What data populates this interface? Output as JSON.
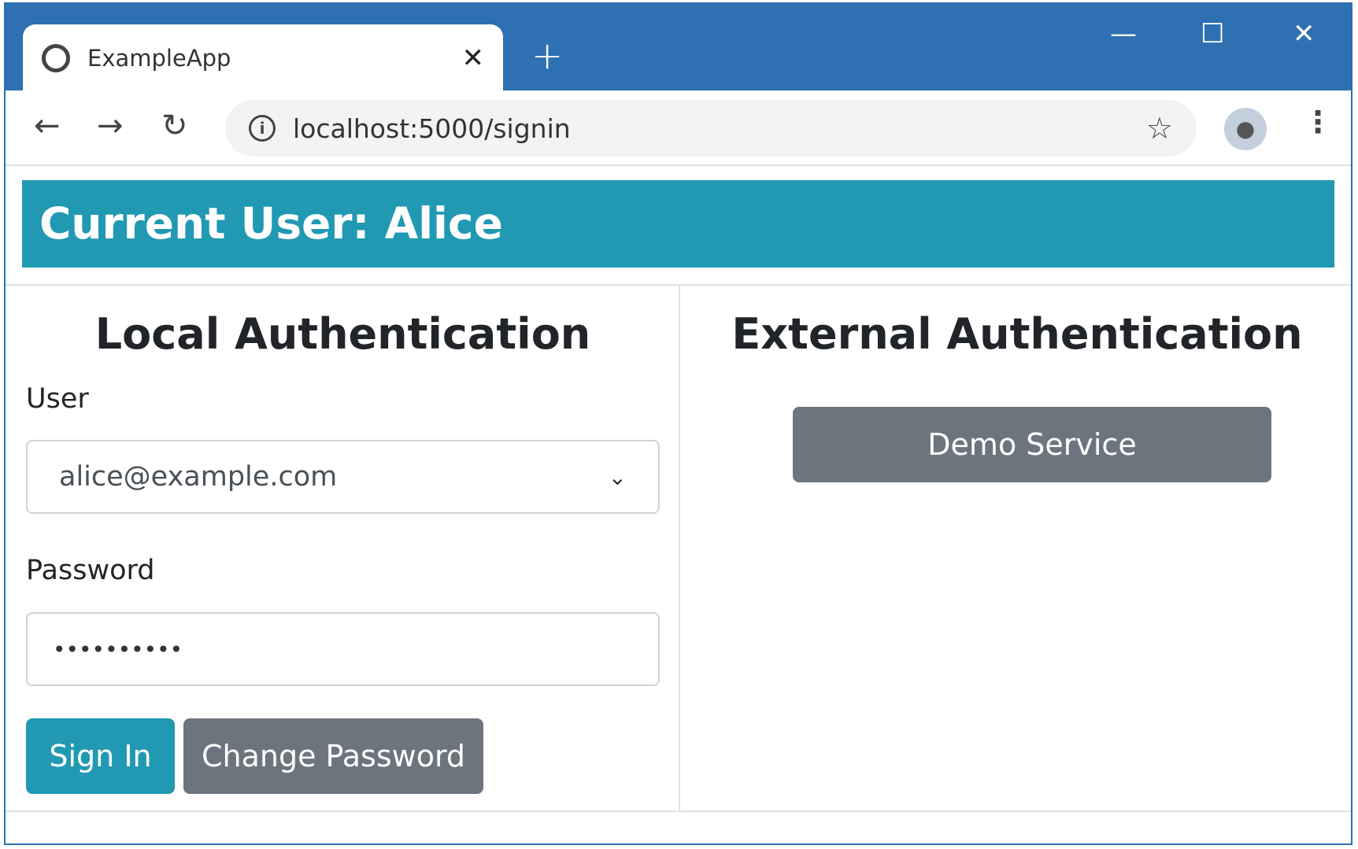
{
  "browser": {
    "tab_title": "ExampleApp",
    "url": "localhost:5000/signin",
    "colors": {
      "chrome": "#2e70b2"
    }
  },
  "header": {
    "title": "Current User: Alice",
    "color": "#2199b2"
  },
  "local": {
    "heading": "Local Authentication",
    "user_label": "User",
    "user_value": "alice@example.com",
    "password_label": "Password",
    "password_value": "••••••••••",
    "sign_in": "Sign In",
    "change_password": "Change Password"
  },
  "external": {
    "heading": "External Authentication",
    "demo_service": "Demo Service"
  },
  "colors": {
    "primary": "#2199b2",
    "secondary": "#6c757d"
  }
}
